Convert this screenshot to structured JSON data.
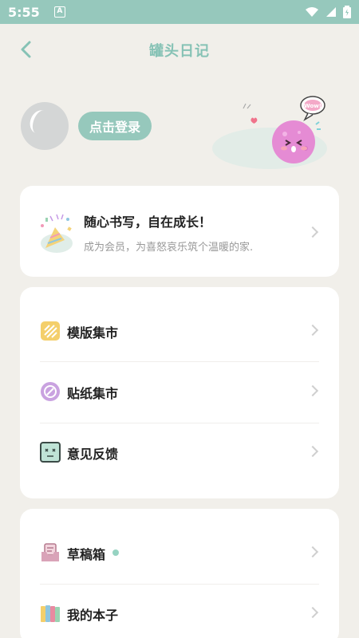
{
  "status_bar": {
    "time": "5:55",
    "notification_badge": "A",
    "icons": [
      "wifi-icon",
      "signal-icon",
      "battery-icon"
    ]
  },
  "header": {
    "title": "罐头日记",
    "back_icon": "chevron-left-icon"
  },
  "profile": {
    "login_label": "点击登录",
    "mascot_speech": "Wow!"
  },
  "vip_banner": {
    "title": "随心书写，自在成长！",
    "subtitle": "成为会员，为喜怒哀乐筑个温暖的家."
  },
  "menu_group_1": [
    {
      "label": "模版集市",
      "icon": "template-icon"
    },
    {
      "label": "贴纸集市",
      "icon": "sticker-icon"
    },
    {
      "label": "意见反馈",
      "icon": "feedback-icon"
    }
  ],
  "menu_group_2": [
    {
      "label": "草稿箱",
      "icon": "draft-box-icon",
      "has_dot": true
    },
    {
      "label": "我的本子",
      "icon": "notebook-icon"
    }
  ],
  "colors": {
    "accent": "#96c8bc",
    "background": "#f1efea",
    "card": "#ffffff"
  }
}
